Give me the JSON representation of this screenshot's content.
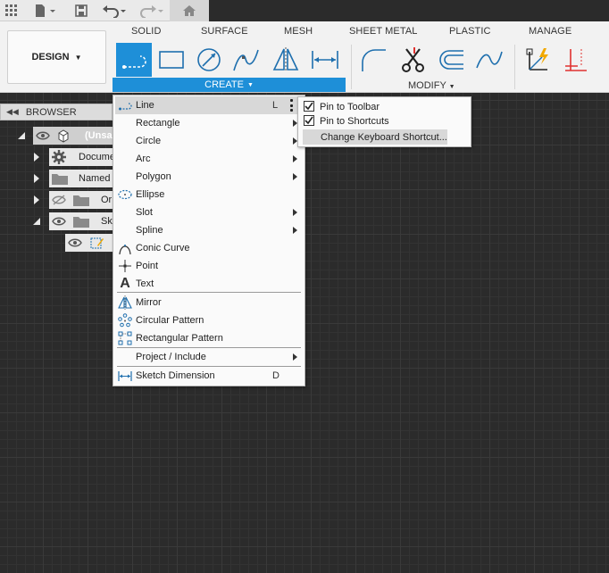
{
  "quick_access": {
    "icons": [
      "grid-icon",
      "file-icon",
      "save-icon",
      "undo-icon",
      "redo-icon",
      "home-icon"
    ]
  },
  "ribbon": {
    "workspace_label": "DESIGN",
    "tabs": [
      "SOLID",
      "SURFACE",
      "MESH",
      "SHEET METAL",
      "PLASTIC",
      "MANAGE"
    ],
    "create_label": "CREATE",
    "modify_label": "MODIFY",
    "accent_color": "#1e8fd8"
  },
  "browser": {
    "title": "BROWSER",
    "rows": [
      {
        "label": "(Unsa"
      },
      {
        "label": "Docume"
      },
      {
        "label": "Named V"
      },
      {
        "label": "Or"
      },
      {
        "label": "Sk"
      },
      {
        "label": ""
      }
    ]
  },
  "create_menu": {
    "items": [
      {
        "label": "Line",
        "shortcut": "L",
        "icon": "line-icon"
      },
      {
        "label": "Rectangle",
        "icon": ""
      },
      {
        "label": "Circle",
        "icon": ""
      },
      {
        "label": "Arc",
        "icon": ""
      },
      {
        "label": "Polygon",
        "icon": ""
      },
      {
        "label": "Ellipse",
        "icon": "ellipse-icon"
      },
      {
        "label": "Slot",
        "icon": ""
      },
      {
        "label": "Spline",
        "icon": ""
      },
      {
        "label": "Conic Curve",
        "icon": "conic-curve-icon"
      },
      {
        "label": "Point",
        "icon": "point-icon"
      },
      {
        "label": "Text",
        "icon": "text-icon"
      },
      {
        "label": "Mirror",
        "icon": "mirror-icon"
      },
      {
        "label": "Circular Pattern",
        "icon": "circular-pattern-icon"
      },
      {
        "label": "Rectangular Pattern",
        "icon": "rectangular-pattern-icon"
      },
      {
        "label": "Project / Include",
        "icon": ""
      },
      {
        "label": "Sketch Dimension",
        "shortcut": "D",
        "icon": "sketch-dimension-icon"
      }
    ]
  },
  "sub_menu": {
    "pin_toolbar": "Pin to Toolbar",
    "pin_shortcuts": "Pin to Shortcuts",
    "change_shortcut": "Change Keyboard Shortcut...",
    "pin_toolbar_checked": true,
    "pin_shortcuts_checked": true
  }
}
